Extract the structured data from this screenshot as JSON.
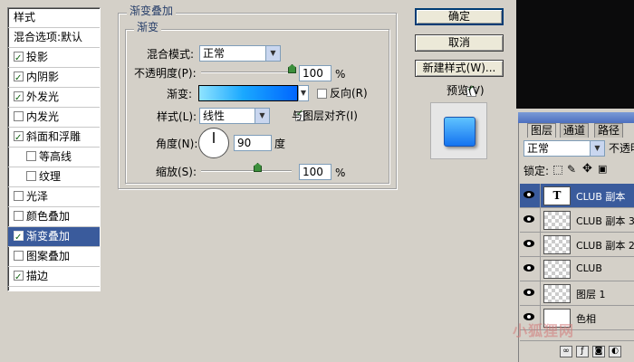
{
  "style_list": {
    "header": "样式",
    "blend_options": "混合选项:默认",
    "items": [
      {
        "label": "投影",
        "checked": true
      },
      {
        "label": "内阴影",
        "checked": true
      },
      {
        "label": "外发光",
        "checked": true
      },
      {
        "label": "内发光",
        "checked": false
      },
      {
        "label": "斜面和浮雕",
        "checked": true
      },
      {
        "label": "等高线",
        "checked": false,
        "sub": true
      },
      {
        "label": "纹理",
        "checked": false,
        "sub": true
      },
      {
        "label": "光泽",
        "checked": false
      },
      {
        "label": "颜色叠加",
        "checked": false
      },
      {
        "label": "渐变叠加",
        "checked": true,
        "selected": true
      },
      {
        "label": "图案叠加",
        "checked": false
      },
      {
        "label": "描边",
        "checked": true
      }
    ]
  },
  "gradient_overlay": {
    "group_title": "渐变叠加",
    "sub_title": "渐变",
    "blend_mode_label": "混合模式:",
    "blend_mode_value": "正常",
    "opacity_label": "不透明度(P):",
    "opacity_value": "100",
    "opacity_fraction": 1.0,
    "percent": "%",
    "gradient_label": "渐变:",
    "reverse_label": "反向(R)",
    "reverse_checked": false,
    "style_label": "样式(L):",
    "style_value": "线性",
    "align_label": "与图层对齐(I)",
    "align_checked": true,
    "angle_label": "角度(N):",
    "angle_value": "90",
    "degree_unit": "度",
    "scale_label": "缩放(S):",
    "scale_value": "100",
    "scale_fraction": 0.5
  },
  "buttons": {
    "ok": "确定",
    "cancel": "取消",
    "new_style": "新建样式(W)...",
    "preview_label": "预览(V)",
    "preview_checked": true
  },
  "layers_panel": {
    "tabs": [
      "图层",
      "通道",
      "路径"
    ],
    "blend_mode": "正常",
    "opacity_label": "不透明",
    "lock_label": "锁定:",
    "layers": [
      {
        "name": "CLUB 副本",
        "type": "text",
        "selected": true
      },
      {
        "name": "CLUB 副本 3",
        "type": "raster"
      },
      {
        "name": "CLUB 副本 2",
        "type": "raster"
      },
      {
        "name": "CLUB",
        "type": "raster"
      },
      {
        "name": "图层 1",
        "type": "raster"
      },
      {
        "name": "色相",
        "type": "adjustment"
      }
    ],
    "text_thumb_glyph": "T"
  },
  "watermark": "小狐狸网"
}
